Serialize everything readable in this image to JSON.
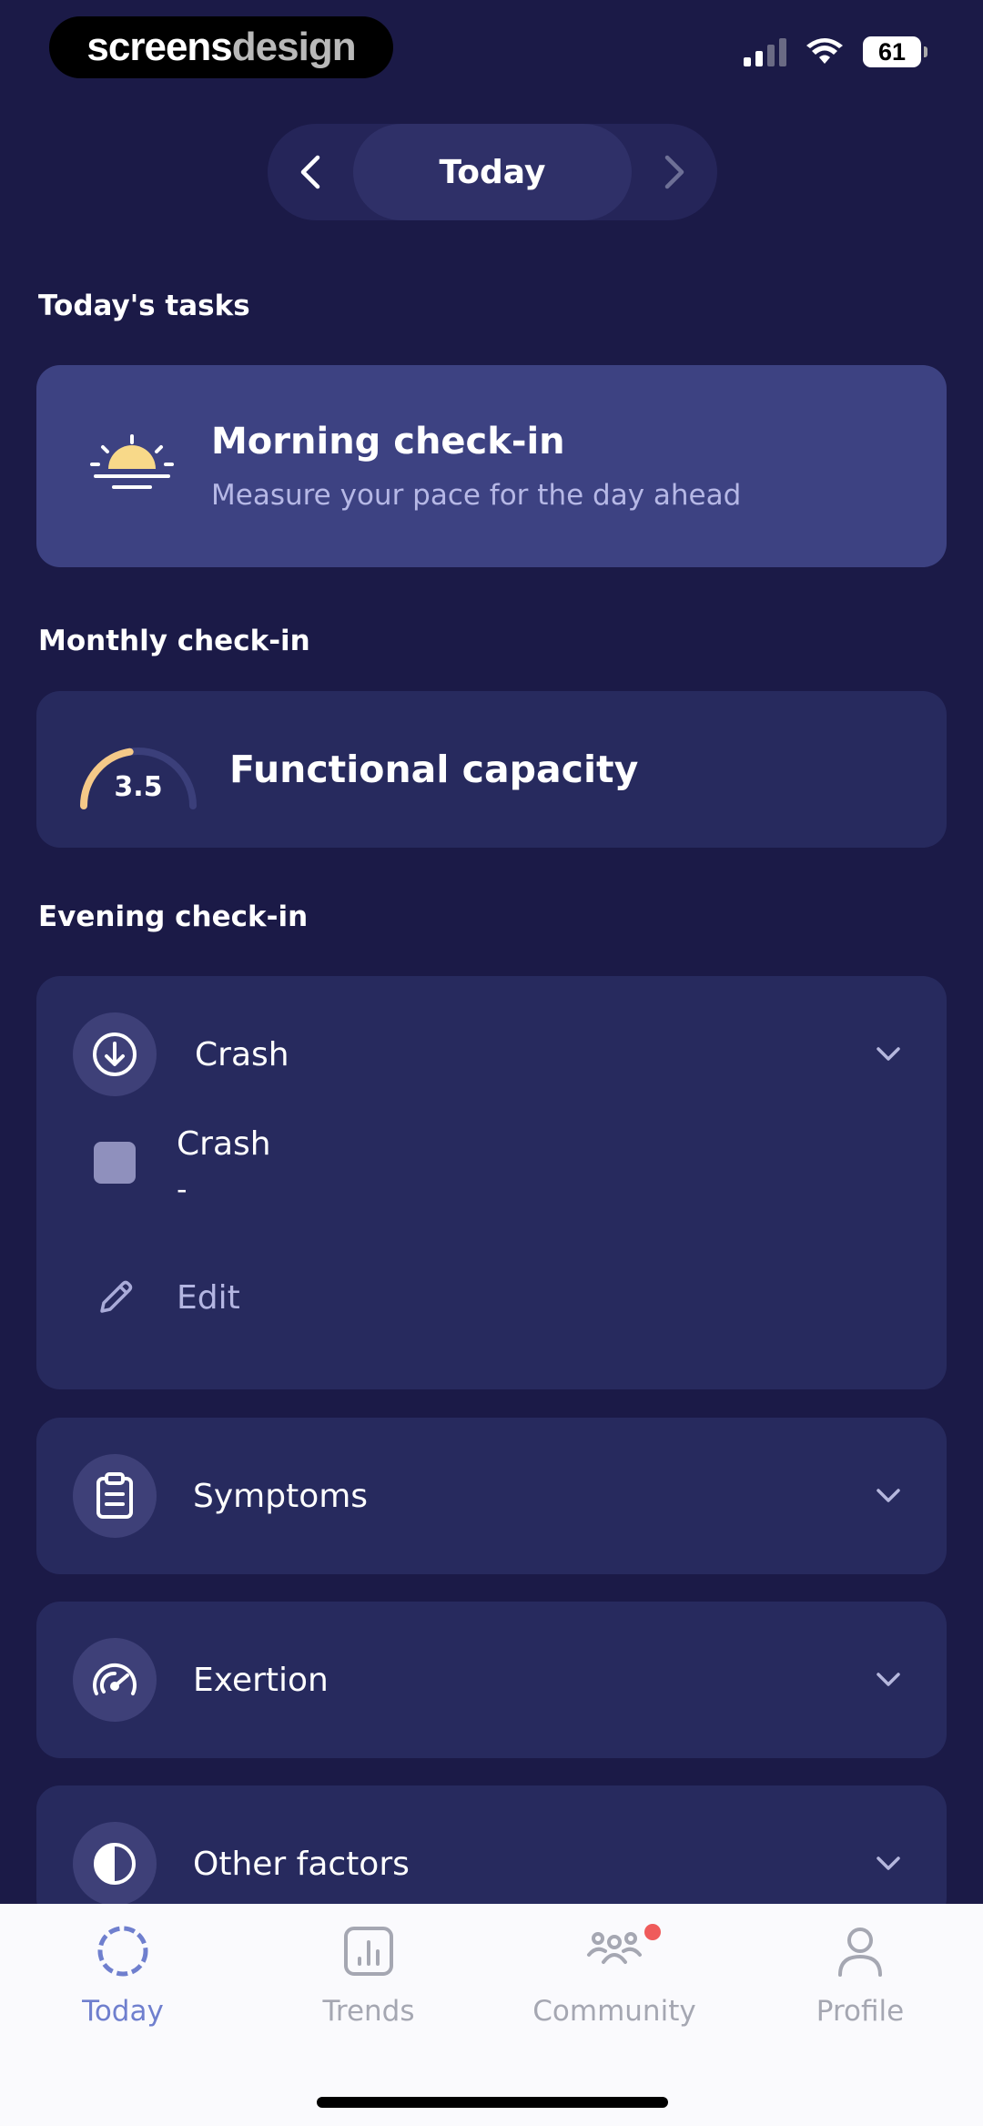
{
  "status_bar": {
    "watermark_part1": "screens",
    "watermark_part2": "design",
    "battery": "61"
  },
  "date_nav": {
    "label": "Today"
  },
  "tasks": {
    "section_title": "Today's tasks",
    "morning": {
      "title": "Morning check-in",
      "subtitle": "Measure your pace for the day ahead"
    }
  },
  "monthly": {
    "section_title": "Monthly check-in",
    "title": "Functional capacity",
    "score": "3.5",
    "gauge_fraction": 0.45,
    "gauge_color": "#f5c988"
  },
  "evening": {
    "section_title": "Evening check-in",
    "crash": {
      "label": "Crash",
      "item_label": "Crash",
      "item_value": "-",
      "edit_label": "Edit"
    },
    "symptoms": {
      "label": "Symptoms"
    },
    "exertion": {
      "label": "Exertion"
    },
    "other": {
      "label": "Other factors"
    }
  },
  "tabs": [
    {
      "label": "Today",
      "icon": "today-icon",
      "active": true
    },
    {
      "label": "Trends",
      "icon": "trends-icon"
    },
    {
      "label": "Community",
      "icon": "community-icon",
      "badge": true
    },
    {
      "label": "Profile",
      "icon": "profile-icon"
    }
  ],
  "colors": {
    "background": "#1b1a47",
    "card": "#272a5e",
    "accent": "#6f7fce",
    "badge": "#ef5b5b"
  }
}
